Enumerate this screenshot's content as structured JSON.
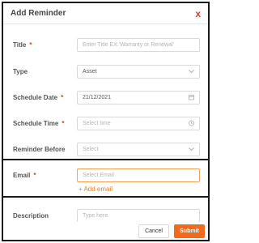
{
  "dialog": {
    "title": "Add Reminder",
    "close_glyph": "x",
    "accent_color": "#e8372b",
    "primary_color": "#f26a1b"
  },
  "fields": {
    "title": {
      "label": "Title",
      "required": "*",
      "placeholder": "Enter Title EX:'Warranty or Renewal'"
    },
    "type": {
      "label": "Type",
      "value": "Asset",
      "icon": "chevron-down-icon"
    },
    "schedule_date": {
      "label": "Schedule Date",
      "required": "*",
      "value": "21/12/2021",
      "icon": "calendar-icon"
    },
    "schedule_time": {
      "label": "Schedule Time",
      "required": "*",
      "placeholder": "Select time",
      "icon": "clock-icon"
    },
    "reminder_before": {
      "label": "Reminder Before",
      "placeholder": "Select",
      "icon": "chevron-down-icon"
    },
    "email": {
      "label": "Email",
      "required": "*",
      "placeholder": "Select Email",
      "add_label": "+ Add email"
    },
    "description": {
      "label": "Description",
      "placeholder": "Type here"
    }
  },
  "footer": {
    "cancel_label": "Cancel",
    "submit_label": "Submit"
  }
}
